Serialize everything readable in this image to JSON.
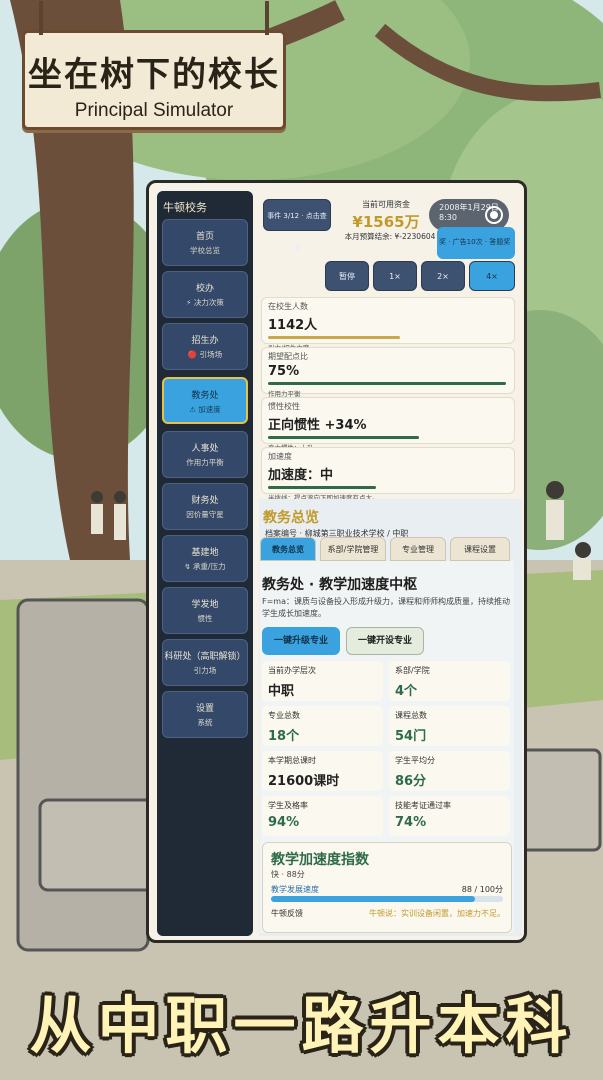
{
  "sign": {
    "title": "坐在树下的校长",
    "subtitle": "Principal Simulator"
  },
  "slogan": "从中职一路升本科",
  "sidebar": {
    "title": "牛顿校务",
    "items": [
      {
        "label": "首页",
        "sub": "学校总览"
      },
      {
        "label": "校办",
        "sub": "⚡ 决力次策"
      },
      {
        "label": "招生办",
        "sub": "🔴 引场场"
      },
      {
        "label": "教务处",
        "sub": "⚠ 加速度"
      },
      {
        "label": "人事处",
        "sub": "作用力平衡"
      },
      {
        "label": "财务处",
        "sub": "因价量守星"
      },
      {
        "label": "基建地",
        "sub": "↯ 承重/压力"
      },
      {
        "label": "学发地",
        "sub": "惯性"
      },
      {
        "label": "科研处（高职解锁）",
        "sub": "引力场"
      },
      {
        "label": "设置",
        "sub": "系统"
      }
    ]
  },
  "header": {
    "event": "事件 3/12 · 点击查看",
    "funds_label": "当前可用资金",
    "funds": "¥1565万",
    "budget": "本月预算结余: ¥-2230604",
    "date": "2008年1月29日",
    "time": "8:30",
    "ad": "奖 · 广告10次 · 答题奖",
    "speeds": [
      "暂停",
      "1×",
      "2×",
      "4×"
    ]
  },
  "metrics": [
    {
      "label": "在校生人数",
      "value": "1142人",
      "hint": "引力/招生力度",
      "progress": 0.55,
      "color": "#c9a84a"
    },
    {
      "label": "期望配点比",
      "value": "75%",
      "hint": "作用力平衡",
      "progress": 0.99,
      "color": "#2f6b4a"
    },
    {
      "label": "惯性校性",
      "value": "正向惯性 +34%",
      "hint": "变力惯性：上升",
      "progress": 0.63,
      "color": "#2f6b4a"
    },
    {
      "label": "加速度",
      "value": "加速度：中",
      "hint": "半拨线：提点滚向下即加速度有点大。",
      "progress": 0.45,
      "color": "#2f6b4a"
    }
  ],
  "overview": {
    "title": "教务总览",
    "subtitle": "档案编号 · 柳城第三职业技术学校 / 中职",
    "tabs": [
      "教务总览",
      "系部/学院管理",
      "专业管理",
      "课程设置"
    ]
  },
  "section": {
    "title": "教务处 · 教学加速度中枢",
    "desc": "F=ma：课质与设备投入形成升级力，课程和师师构成质量，持续推动学生成长加速度。",
    "btn_upgrade": "一键升级专业",
    "btn_open": "一键开设专业"
  },
  "stats": [
    {
      "label": "当前办学层次",
      "value": "中职",
      "color": "#222"
    },
    {
      "label": "系部/学院",
      "value": "4个",
      "color": "#2f6b4a"
    },
    {
      "label": "专业总数",
      "value": "18个",
      "color": "#2f6b4a"
    },
    {
      "label": "课程总数",
      "value": "54门",
      "color": "#2f6b4a"
    },
    {
      "label": "本学期总课时",
      "value": "21600课时",
      "color": "#222"
    },
    {
      "label": "学生平均分",
      "value": "86分",
      "color": "#2f6b4a"
    },
    {
      "label": "学生及格率",
      "value": "94%",
      "color": "#2f6b4a"
    },
    {
      "label": "技能考证通过率",
      "value": "74%",
      "color": "#2f6b4a"
    }
  ],
  "index": {
    "title": "教学加速度指数",
    "speed": "快 · 88分",
    "bar_label": "教学发展速度",
    "score": "88 / 100分",
    "progress": 0.88,
    "feedback_label": "牛顿反馈",
    "feedback": "牛顿说：实训设备闲置，加速力不足。"
  }
}
